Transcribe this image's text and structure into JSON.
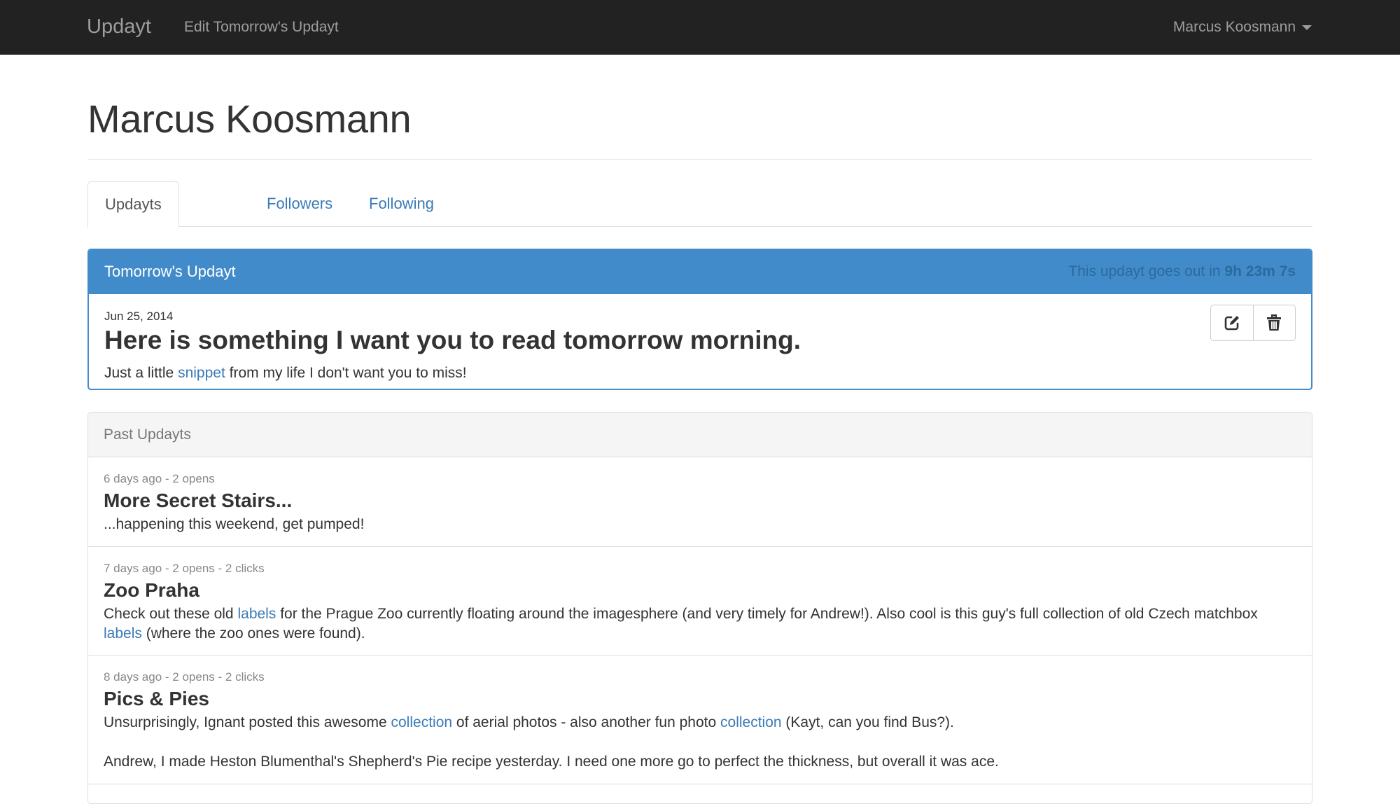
{
  "nav": {
    "brand": "Updayt",
    "edit_link": "Edit Tomorrow's Updayt",
    "user_name": "Marcus Koosmann"
  },
  "profile": {
    "name": "Marcus Koosmann"
  },
  "tabs": [
    {
      "label": "Updayts",
      "active": true
    },
    {
      "label": "Followers",
      "active": false
    },
    {
      "label": "Following",
      "active": false
    }
  ],
  "tomorrow": {
    "header": "Tomorrow's Updayt",
    "countdown_prefix": "This updayt goes out in",
    "countdown_h": "9h",
    "countdown_m": "23m",
    "countdown_s": "7s",
    "date": "Jun 25, 2014",
    "title": "Here is something I want you to read tomorrow morning.",
    "body_before": "Just a little",
    "body_link": "snippet",
    "body_after": "from my life I don't want you to miss!",
    "edit_icon": "edit-icon",
    "delete_icon": "trash-icon"
  },
  "past": {
    "header": "Past Updayts",
    "items": [
      {
        "meta": "6 days ago - 2 opens",
        "title": "More Secret Stairs...",
        "body": "...happening this weekend, get pumped!"
      },
      {
        "meta": "7 days ago - 2 opens - 2 clicks",
        "title": "Zoo Praha",
        "body_1": "Check out these old",
        "link_1": "labels",
        "body_2": "for the Prague Zoo currently floating around the imagesphere (and very timely for Andrew!). Also cool is this guy's full collection of old Czech",
        "body_3": "matchbox",
        "link_2": "labels",
        "body_4": "(where the zoo ones were found)."
      },
      {
        "meta": "8 days ago - 2 opens - 2 clicks",
        "title": "Pics & Pies",
        "body_1": "Unsurprisingly, Ignant posted this awesome",
        "link_1": "collection",
        "body_2": "of aerial photos - also another fun photo",
        "link_2": "collection",
        "body_3": "(Kayt, can you find Bus?).",
        "body_4": "Andrew, I made Heston Blumenthal's Shepherd's Pie recipe yesterday. I need one more go to perfect the thickness, but overall it was ace."
      }
    ]
  }
}
